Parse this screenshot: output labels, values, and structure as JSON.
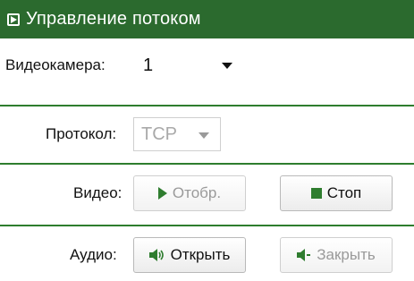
{
  "header": {
    "title": "Управление потоком",
    "icon": "play-square-icon"
  },
  "camera": {
    "label": "Видеокамера:",
    "value": "1"
  },
  "protocol": {
    "label": "Протокол:",
    "value": "TCP"
  },
  "video": {
    "label": "Видео:",
    "show_label": "Отобр.",
    "stop_label": "Стоп"
  },
  "audio": {
    "label": "Аудио:",
    "open_label": "Открыть",
    "close_label": "Закрыть"
  },
  "colors": {
    "header_bg": "#2b6a2e",
    "divider": "#2e7d2e",
    "play": "#2f7d2f"
  }
}
